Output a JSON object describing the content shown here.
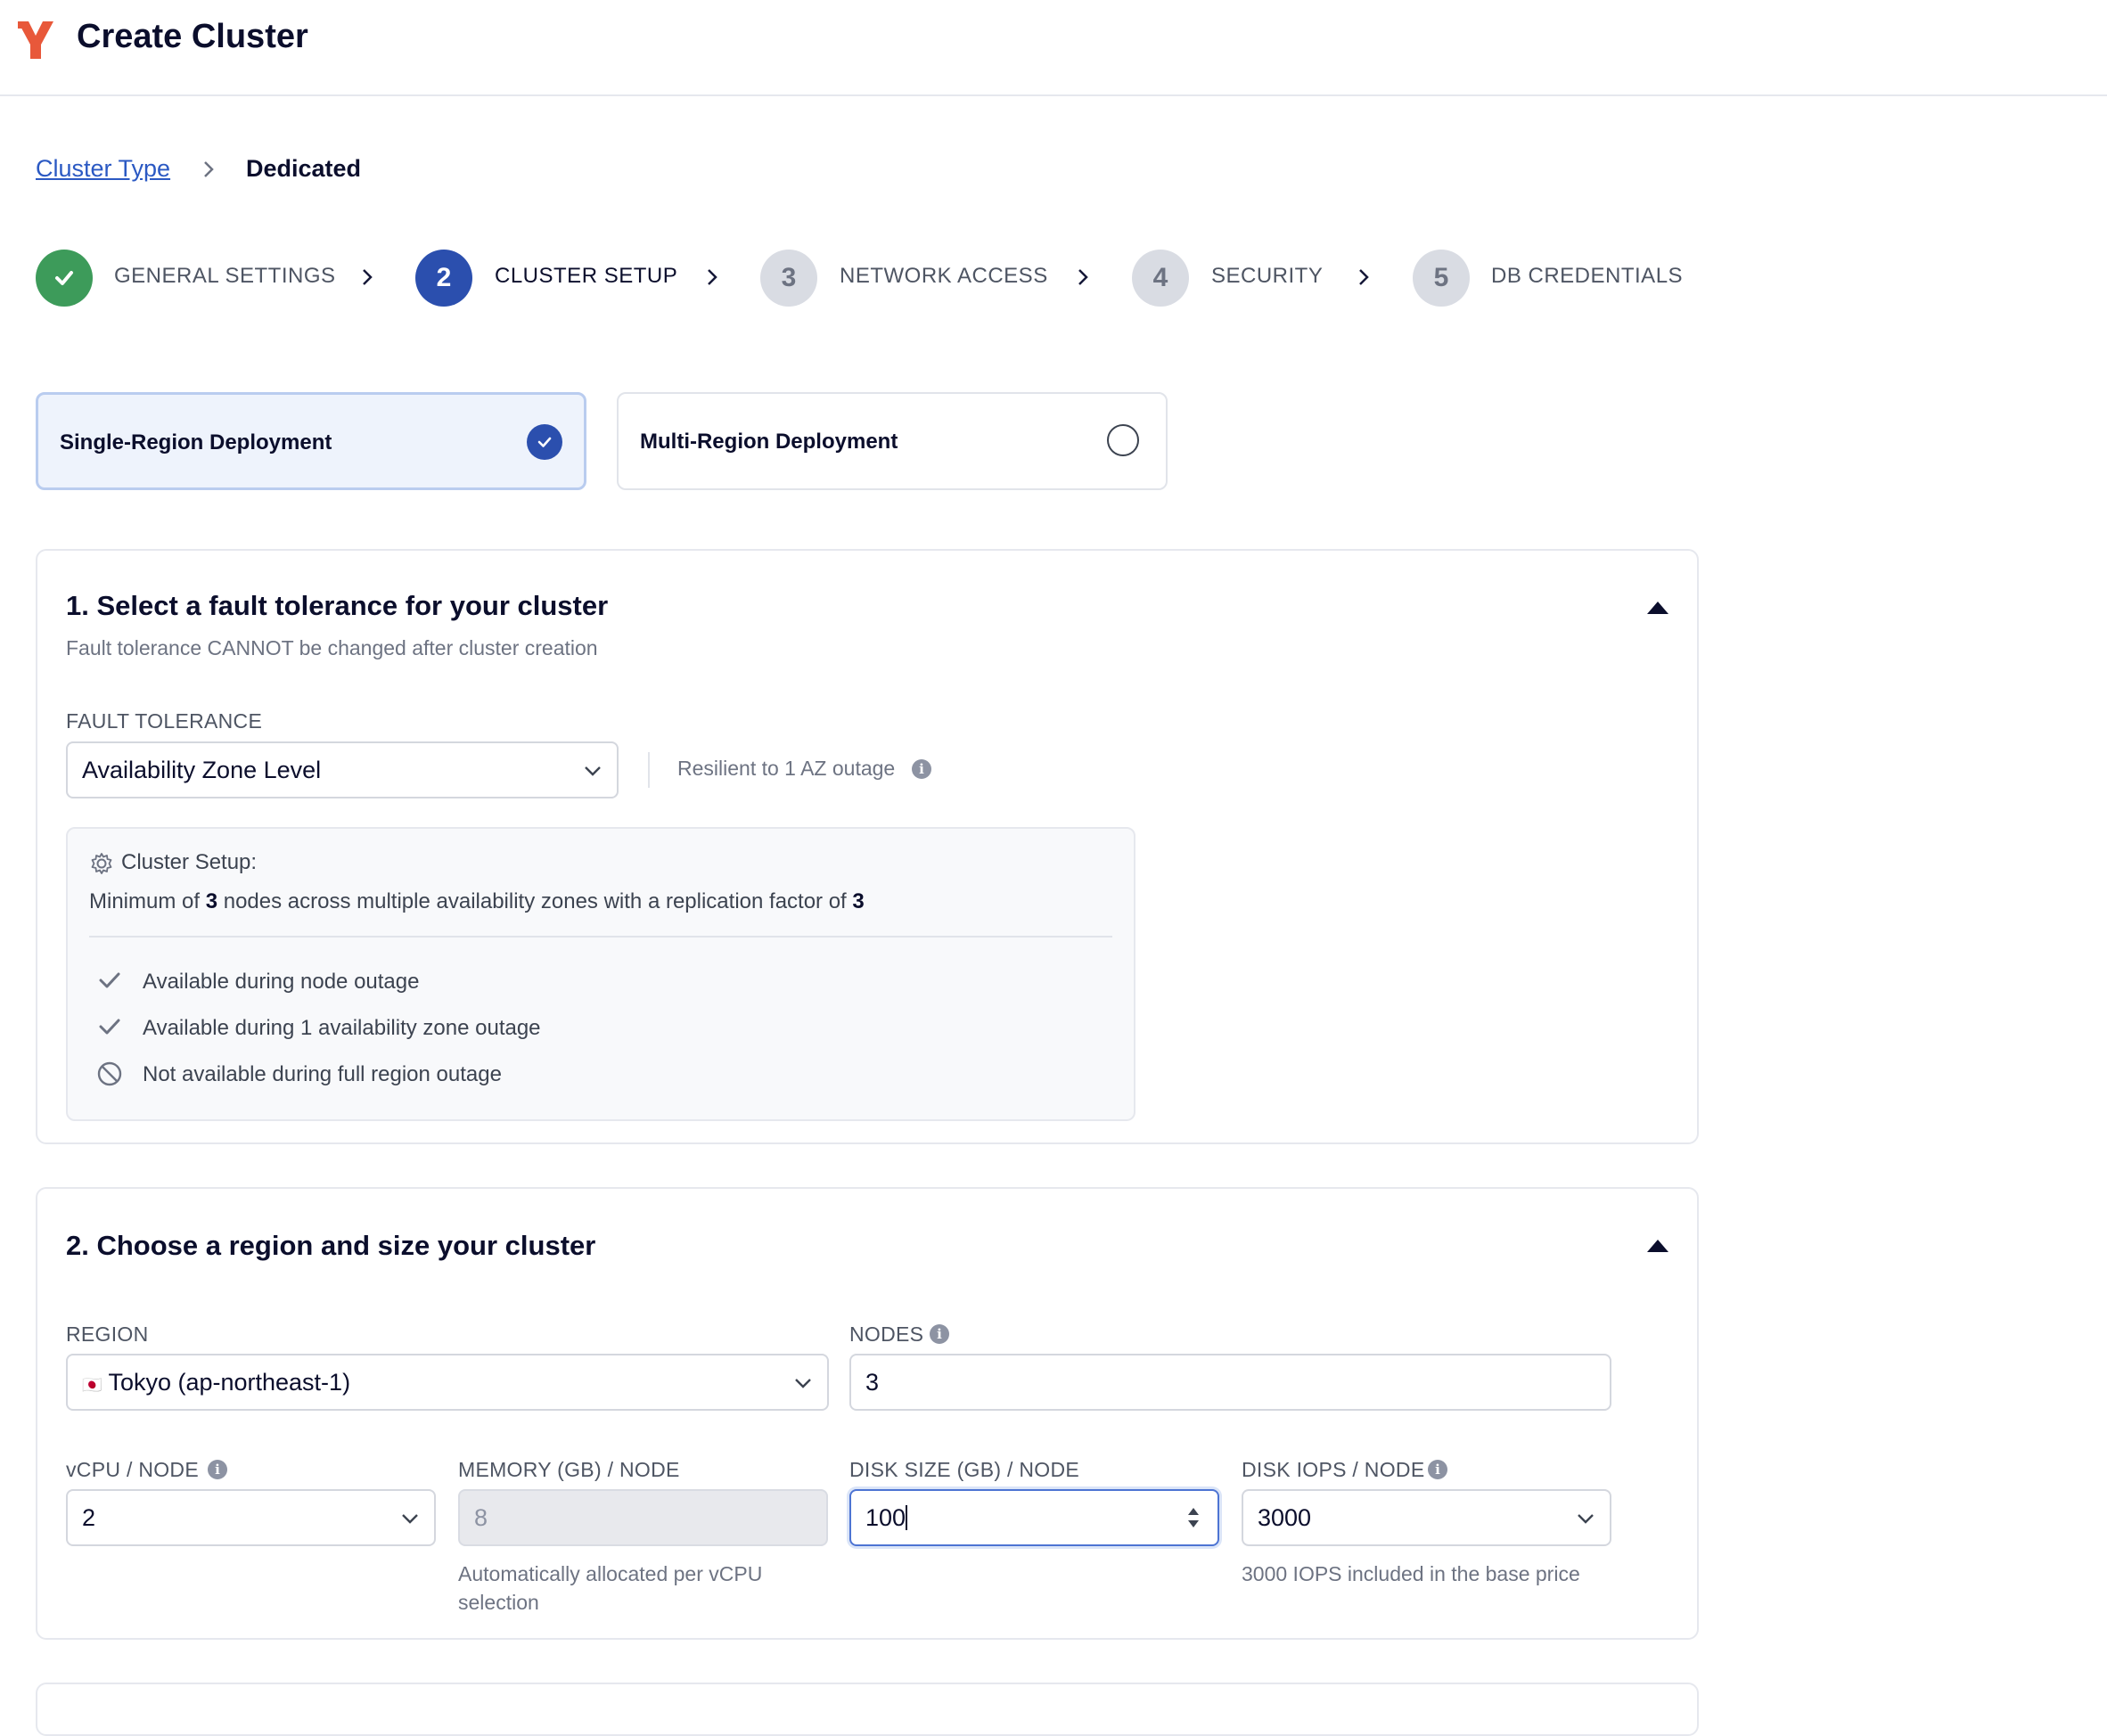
{
  "header": {
    "title": "Create Cluster"
  },
  "breadcrumb": {
    "parent": "Cluster Type",
    "current": "Dedicated"
  },
  "steps": [
    {
      "number": "",
      "label": "GENERAL SETTINGS",
      "state": "complete"
    },
    {
      "number": "2",
      "label": "CLUSTER SETUP",
      "state": "active"
    },
    {
      "number": "3",
      "label": "NETWORK ACCESS",
      "state": "pending"
    },
    {
      "number": "4",
      "label": "SECURITY",
      "state": "pending"
    },
    {
      "number": "5",
      "label": "DB CREDENTIALS",
      "state": "pending"
    }
  ],
  "deployment": {
    "single": {
      "label": "Single-Region Deployment",
      "selected": true
    },
    "multi": {
      "label": "Multi-Region Deployment",
      "selected": false
    }
  },
  "fault_section": {
    "title": "1. Select a fault tolerance for your cluster",
    "subtitle": "Fault tolerance CANNOT be changed after cluster creation",
    "field_label": "FAULT TOLERANCE",
    "value": "Availability Zone Level",
    "resilience_note": "Resilient to 1 AZ outage",
    "setup_box": {
      "heading": "Cluster Setup:",
      "desc_prefix": "Minimum of ",
      "nodes": "3",
      "desc_middle": " nodes across multiple availability zones with a replication factor of ",
      "replication": "3",
      "features": [
        {
          "text": "Available during node outage",
          "icon": "check-icon"
        },
        {
          "text": "Available during 1 availability zone outage",
          "icon": "check-icon"
        },
        {
          "text": "Not available during full region outage",
          "icon": "prohibited-icon"
        }
      ]
    }
  },
  "region_section": {
    "title": "2. Choose a region and size your cluster",
    "region_label": "REGION",
    "region_flag": "🇯🇵",
    "region_value": "Tokyo (ap-northeast-1)",
    "nodes_label": "NODES",
    "nodes_value": "3",
    "vcpu_label": "vCPU / NODE",
    "vcpu_value": "2",
    "memory_label": "MEMORY (GB) / NODE",
    "memory_value": "8",
    "memory_hint": "Automatically allocated per vCPU selection",
    "disk_label": "DISK SIZE (GB) / NODE",
    "disk_value": "100",
    "iops_label": "DISK IOPS / NODE",
    "iops_value": "3000",
    "iops_hint": "3000 IOPS included in the base price"
  },
  "colors": {
    "accent": "#2b4fae",
    "success": "#3d9b5a",
    "brand": "#e8583a",
    "pending_step": "#d9dce3"
  }
}
